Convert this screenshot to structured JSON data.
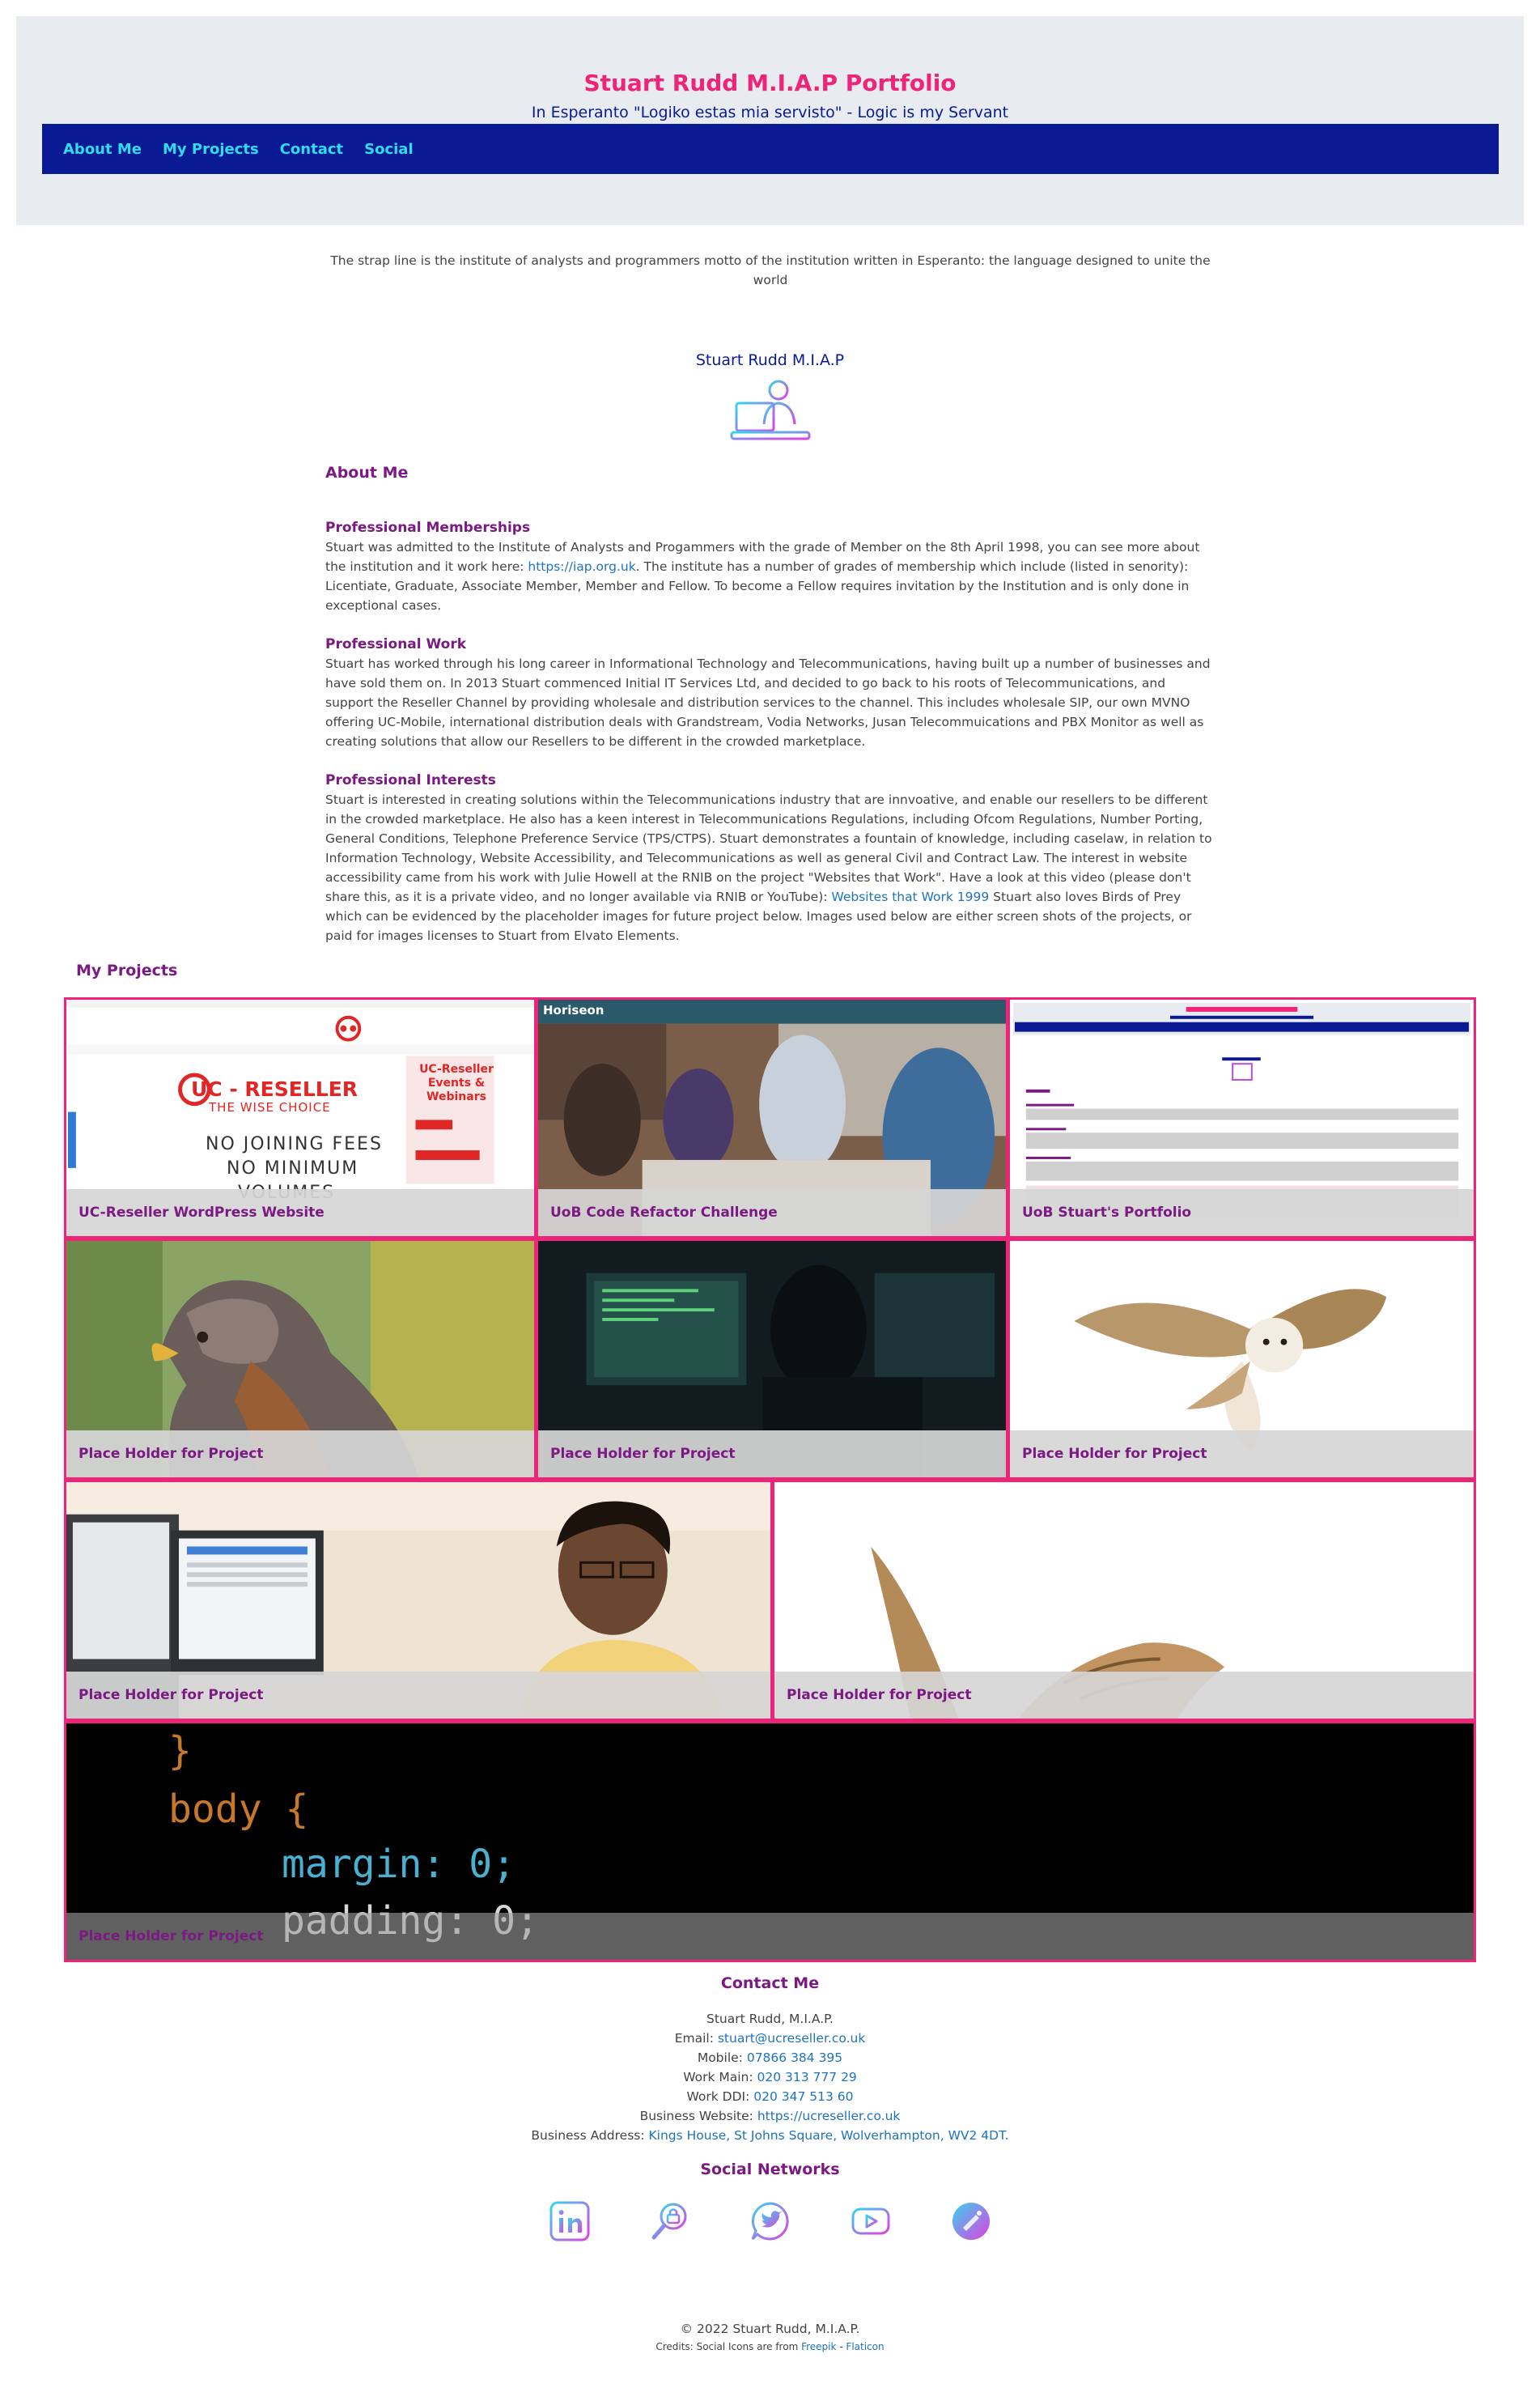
{
  "header": {
    "title": "Stuart Rudd M.I.A.P Portfolio",
    "tagline": "In Esperanto \"Logiko estas mia servisto\" - Logic is my Servant",
    "nav": [
      "About Me",
      "My Projects",
      "Contact",
      "Social"
    ]
  },
  "strap_line": "The strap line is the institute of analysts and programmers motto of the institution written in Esperanto: the language designed to unite the world",
  "profile": {
    "name": "Stuart Rudd M.I.A.P",
    "icon": "developer-at-laptop-icon"
  },
  "about": {
    "heading": "About Me",
    "memberships": {
      "heading": "Professional Memberships",
      "text_before": "Stuart was admitted to the Institute of Analysts and Progammers with the grade of Member on the 8th April 1998, you can see more about the institution and it work here: ",
      "link": "https://iap.org.uk",
      "text_after": ". The institute has a number of grades of membership which include (listed in senority): Licentiate, Graduate, Associate Member, Member and Fellow. To become a Fellow requires invitation by the Institution and is only done in exceptional cases."
    },
    "work": {
      "heading": "Professional Work",
      "text": "Stuart has worked through his long career in Informational Technology and Telecommunications, having built up a number of businesses and have sold them on. In 2013 Stuart commenced Initial IT Services Ltd, and decided to go back to his roots of Telecommunications, and support the Reseller Channel by providing wholesale and distribution services to the channel. This includes wholesale SIP, our own MVNO offering UC-Mobile, international distribution deals with Grandstream, Vodia Networks, Jusan Telecommuications and PBX Monitor as well as creating solutions that allow our Resellers to be different in the crowded marketplace."
    },
    "interests": {
      "heading": "Professional Interests",
      "text_before": "Stuart is interested in creating solutions within the Telecommunications industry that are innvoative, and enable our resellers to be different in the crowded marketplace. He also has a keen interest in Telecommunications Regulations, including Ofcom Regulations, Number Porting, General Conditions, Telephone Preference Service (TPS/CTPS). Stuart demonstrates a fountain of knowledge, including caselaw, in relation to Information Technology, Website Accessibility, and Telecommunications as well as general Civil and Contract Law. The interest in website accessibility came from his work with Julie Howell at the RNIB on the project \"Websites that Work\". Have a look at this video (please don't share this, as it is a private video, and no longer available via RNIB or YouTube): ",
      "link": "Websites that Work 1999",
      "text_after": " Stuart also loves Birds of Prey which can be evidenced by the placeholder images for future project below. Images used below are either screen shots of the projects, or paid for images licenses to Stuart from Elvato Elements."
    }
  },
  "projects": {
    "heading": "My Projects",
    "tiles": [
      {
        "caption": "UC-Reseller WordPress Website",
        "art": "uc-reseller-screenshot"
      },
      {
        "caption": "UoB Code Refactor Challenge",
        "art": "horiseon-screenshot",
        "inner_text": "Horiseon"
      },
      {
        "caption": "UoB Stuart's Portfolio",
        "art": "portfolio-screenshot"
      },
      {
        "caption": "Place Holder for Project",
        "art": "hawk-photo"
      },
      {
        "caption": "Place Holder for Project",
        "art": "developer-dark-photo"
      },
      {
        "caption": "Place Holder for Project",
        "art": "barn-owl-photo"
      },
      {
        "caption": "Place Holder for Project",
        "art": "smiling-man-photo"
      },
      {
        "caption": "Place Holder for Project",
        "art": "owl-wing-photo"
      },
      {
        "caption": "Place Holder for Project",
        "art": "css-code-photo",
        "code_lines": [
          "}",
          "body {",
          "margin: 0;",
          "padding: 0;"
        ]
      }
    ],
    "uc_reseller": {
      "brand": "UC - RESELLER",
      "slogan": "THE WISE CHOICE",
      "events": "UC-Reseller Events & Webinars",
      "line1": "NO JOINING FEES",
      "line2": "NO MINIMUM",
      "line3": "VOLUMES"
    }
  },
  "contact": {
    "heading": "Contact Me",
    "name": "Stuart Rudd, M.I.A.P.",
    "email_label": "Email: ",
    "email": "stuart@ucreseller.co.uk",
    "mobile_label": "Mobile: ",
    "mobile": "07866 384 395",
    "work_main_label": "Work Main: ",
    "work_main": "020 313 777 29",
    "work_ddi_label": "Work DDI: ",
    "work_ddi": "020 347 513 60",
    "website_label": "Business Website: ",
    "website": "https://ucreseller.co.uk",
    "address_label": "Business Address: ",
    "address": "Kings House, St Johns Square, Wolverhampton, WV2 4DT."
  },
  "social": {
    "heading": "Social Networks",
    "icons": [
      "linkedin-icon",
      "search-security-icon",
      "twitter-icon",
      "youtube-icon",
      "gradient-brand-icon"
    ]
  },
  "footer": {
    "copyright": "© 2022 Stuart Rudd, M.I.A.P.",
    "credits_prefix": "Credits: Social Icons are from ",
    "credit_link1": "Freepik",
    "credits_sep": " - ",
    "credit_link2": "Flaticon"
  },
  "colors": {
    "accent_pink": "#ee2479",
    "nav_blue": "#0a1a94",
    "nav_link": "#2fdcf2",
    "heading_purple": "#7a1a82",
    "link_blue": "#1e73be"
  }
}
